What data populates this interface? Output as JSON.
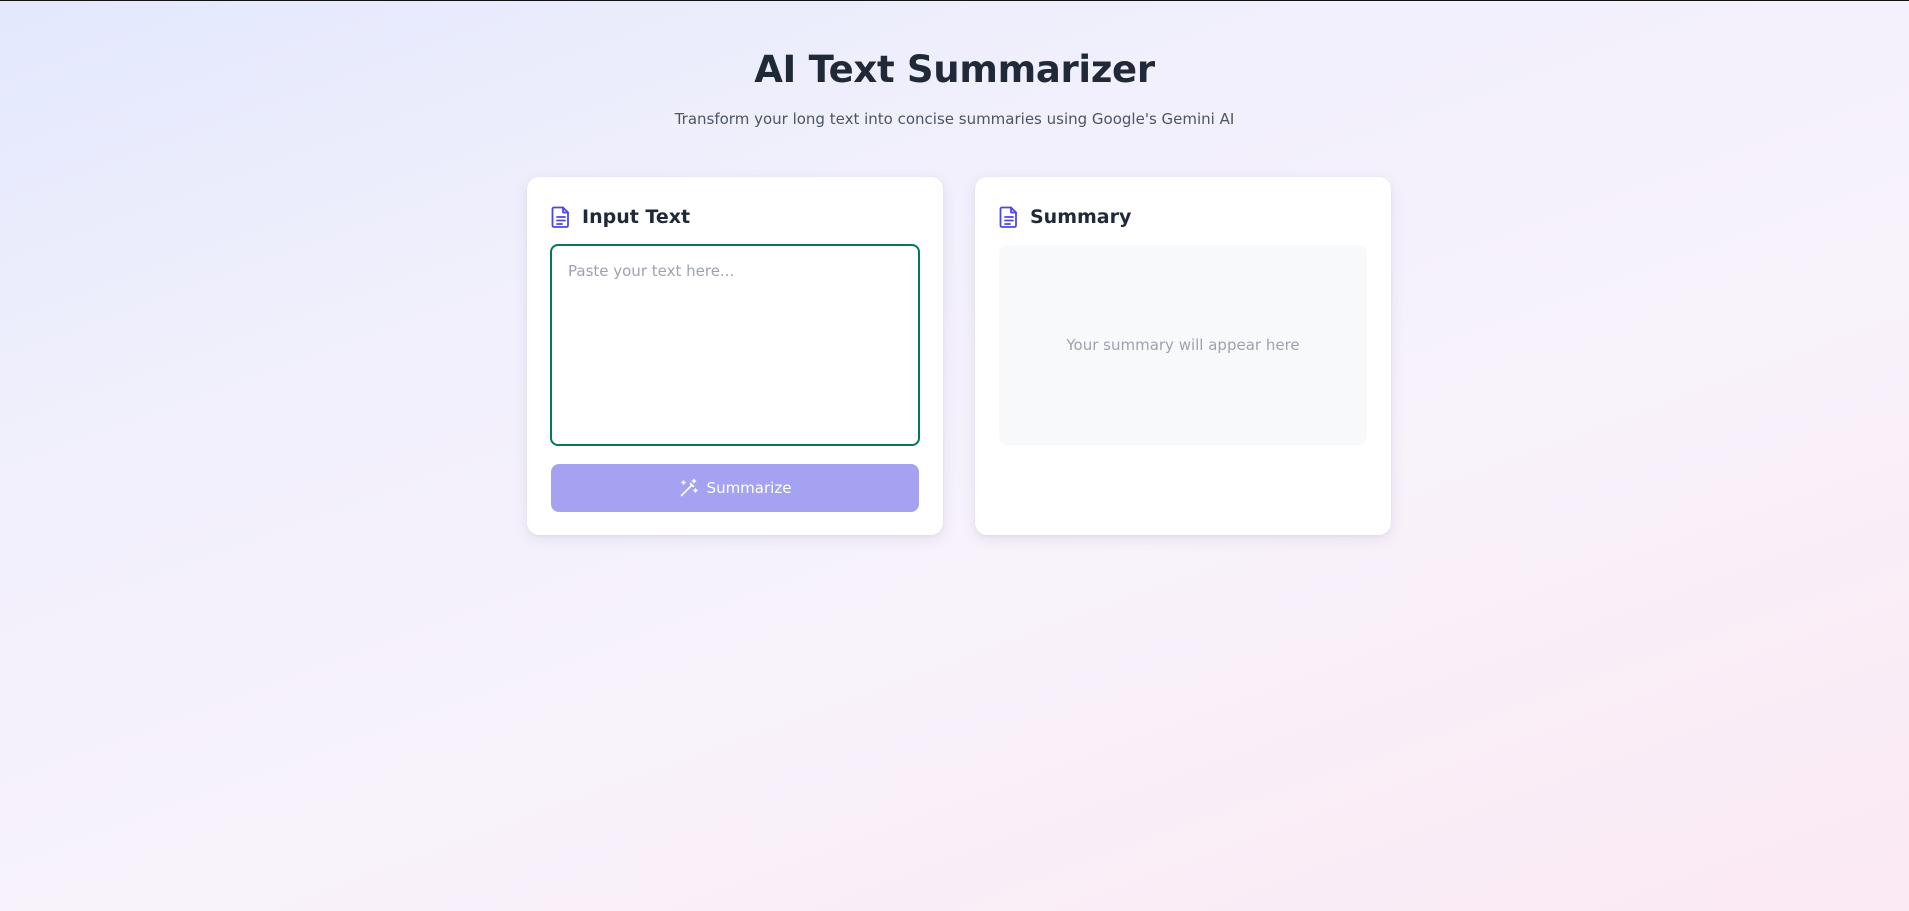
{
  "header": {
    "title": "AI Text Summarizer",
    "subtitle": "Transform your long text into concise summaries using Google's Gemini AI"
  },
  "input_card": {
    "title": "Input Text",
    "icon": "document-icon",
    "textarea": {
      "value": "",
      "placeholder": "Paste your text here..."
    },
    "button": {
      "label": "Summarize",
      "icon": "magic-wand-icon",
      "state": "disabled"
    }
  },
  "summary_card": {
    "title": "Summary",
    "icon": "document-icon",
    "placeholder": "Your summary will appear here"
  },
  "colors": {
    "accent": "#4f46e5",
    "button_disabled": "#a5a3f1",
    "input_focus_border": "#047857",
    "summary_box_bg": "#f8f9fb"
  }
}
